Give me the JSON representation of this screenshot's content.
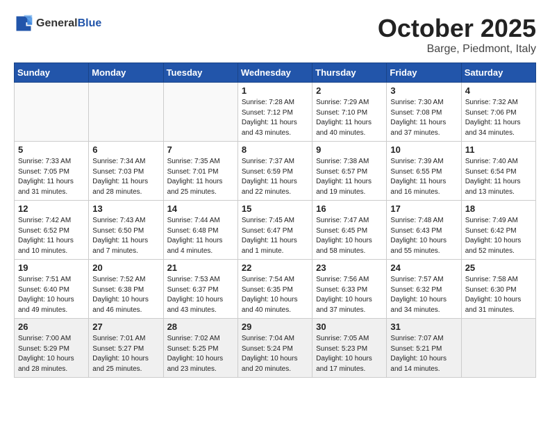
{
  "header": {
    "logo_general": "General",
    "logo_blue": "Blue",
    "month_title": "October 2025",
    "location": "Barge, Piedmont, Italy"
  },
  "weekdays": [
    "Sunday",
    "Monday",
    "Tuesday",
    "Wednesday",
    "Thursday",
    "Friday",
    "Saturday"
  ],
  "weeks": [
    [
      {
        "day": "",
        "detail": ""
      },
      {
        "day": "",
        "detail": ""
      },
      {
        "day": "",
        "detail": ""
      },
      {
        "day": "1",
        "detail": "Sunrise: 7:28 AM\nSunset: 7:12 PM\nDaylight: 11 hours and 43 minutes."
      },
      {
        "day": "2",
        "detail": "Sunrise: 7:29 AM\nSunset: 7:10 PM\nDaylight: 11 hours and 40 minutes."
      },
      {
        "day": "3",
        "detail": "Sunrise: 7:30 AM\nSunset: 7:08 PM\nDaylight: 11 hours and 37 minutes."
      },
      {
        "day": "4",
        "detail": "Sunrise: 7:32 AM\nSunset: 7:06 PM\nDaylight: 11 hours and 34 minutes."
      }
    ],
    [
      {
        "day": "5",
        "detail": "Sunrise: 7:33 AM\nSunset: 7:05 PM\nDaylight: 11 hours and 31 minutes."
      },
      {
        "day": "6",
        "detail": "Sunrise: 7:34 AM\nSunset: 7:03 PM\nDaylight: 11 hours and 28 minutes."
      },
      {
        "day": "7",
        "detail": "Sunrise: 7:35 AM\nSunset: 7:01 PM\nDaylight: 11 hours and 25 minutes."
      },
      {
        "day": "8",
        "detail": "Sunrise: 7:37 AM\nSunset: 6:59 PM\nDaylight: 11 hours and 22 minutes."
      },
      {
        "day": "9",
        "detail": "Sunrise: 7:38 AM\nSunset: 6:57 PM\nDaylight: 11 hours and 19 minutes."
      },
      {
        "day": "10",
        "detail": "Sunrise: 7:39 AM\nSunset: 6:55 PM\nDaylight: 11 hours and 16 minutes."
      },
      {
        "day": "11",
        "detail": "Sunrise: 7:40 AM\nSunset: 6:54 PM\nDaylight: 11 hours and 13 minutes."
      }
    ],
    [
      {
        "day": "12",
        "detail": "Sunrise: 7:42 AM\nSunset: 6:52 PM\nDaylight: 11 hours and 10 minutes."
      },
      {
        "day": "13",
        "detail": "Sunrise: 7:43 AM\nSunset: 6:50 PM\nDaylight: 11 hours and 7 minutes."
      },
      {
        "day": "14",
        "detail": "Sunrise: 7:44 AM\nSunset: 6:48 PM\nDaylight: 11 hours and 4 minutes."
      },
      {
        "day": "15",
        "detail": "Sunrise: 7:45 AM\nSunset: 6:47 PM\nDaylight: 11 hours and 1 minute."
      },
      {
        "day": "16",
        "detail": "Sunrise: 7:47 AM\nSunset: 6:45 PM\nDaylight: 10 hours and 58 minutes."
      },
      {
        "day": "17",
        "detail": "Sunrise: 7:48 AM\nSunset: 6:43 PM\nDaylight: 10 hours and 55 minutes."
      },
      {
        "day": "18",
        "detail": "Sunrise: 7:49 AM\nSunset: 6:42 PM\nDaylight: 10 hours and 52 minutes."
      }
    ],
    [
      {
        "day": "19",
        "detail": "Sunrise: 7:51 AM\nSunset: 6:40 PM\nDaylight: 10 hours and 49 minutes."
      },
      {
        "day": "20",
        "detail": "Sunrise: 7:52 AM\nSunset: 6:38 PM\nDaylight: 10 hours and 46 minutes."
      },
      {
        "day": "21",
        "detail": "Sunrise: 7:53 AM\nSunset: 6:37 PM\nDaylight: 10 hours and 43 minutes."
      },
      {
        "day": "22",
        "detail": "Sunrise: 7:54 AM\nSunset: 6:35 PM\nDaylight: 10 hours and 40 minutes."
      },
      {
        "day": "23",
        "detail": "Sunrise: 7:56 AM\nSunset: 6:33 PM\nDaylight: 10 hours and 37 minutes."
      },
      {
        "day": "24",
        "detail": "Sunrise: 7:57 AM\nSunset: 6:32 PM\nDaylight: 10 hours and 34 minutes."
      },
      {
        "day": "25",
        "detail": "Sunrise: 7:58 AM\nSunset: 6:30 PM\nDaylight: 10 hours and 31 minutes."
      }
    ],
    [
      {
        "day": "26",
        "detail": "Sunrise: 7:00 AM\nSunset: 5:29 PM\nDaylight: 10 hours and 28 minutes."
      },
      {
        "day": "27",
        "detail": "Sunrise: 7:01 AM\nSunset: 5:27 PM\nDaylight: 10 hours and 25 minutes."
      },
      {
        "day": "28",
        "detail": "Sunrise: 7:02 AM\nSunset: 5:25 PM\nDaylight: 10 hours and 23 minutes."
      },
      {
        "day": "29",
        "detail": "Sunrise: 7:04 AM\nSunset: 5:24 PM\nDaylight: 10 hours and 20 minutes."
      },
      {
        "day": "30",
        "detail": "Sunrise: 7:05 AM\nSunset: 5:23 PM\nDaylight: 10 hours and 17 minutes."
      },
      {
        "day": "31",
        "detail": "Sunrise: 7:07 AM\nSunset: 5:21 PM\nDaylight: 10 hours and 14 minutes."
      },
      {
        "day": "",
        "detail": ""
      }
    ]
  ]
}
